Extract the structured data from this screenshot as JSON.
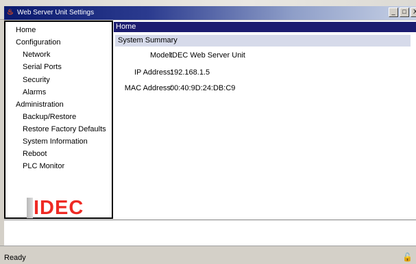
{
  "window": {
    "title": "Web Server Unit Settings",
    "icon": "java-cup-icon",
    "buttons": [
      "_",
      "□",
      "X"
    ]
  },
  "sidebar": {
    "items": [
      {
        "label": "Home",
        "level": 0
      },
      {
        "label": "Configuration",
        "level": 0
      },
      {
        "label": "Network",
        "level": 1
      },
      {
        "label": "Serial Ports",
        "level": 1
      },
      {
        "label": "Security",
        "level": 1
      },
      {
        "label": "Alarms",
        "level": 1
      },
      {
        "label": "Administration",
        "level": 0
      },
      {
        "label": "Backup/Restore",
        "level": 1
      },
      {
        "label": "Restore Factory Defaults",
        "level": 1
      },
      {
        "label": "System Information",
        "level": 1
      },
      {
        "label": "Reboot",
        "level": 1
      },
      {
        "label": "PLC Monitor",
        "level": 1
      }
    ],
    "logo_text": "IDEC"
  },
  "main": {
    "header": "Home",
    "section_title": "System Summary",
    "rows": [
      {
        "label": "Model:",
        "value": "IDEC Web Server Unit"
      },
      {
        "label": "IP Address:",
        "value": "192.168.1.5"
      },
      {
        "label": "MAC Address:",
        "value": "00:40:9D:24:DB:C9"
      }
    ]
  },
  "status": {
    "text": "Ready",
    "icon": "lock-icon"
  },
  "colors": {
    "header_bg": "#1c1c70",
    "section_bg": "#d6daea",
    "logo_red": "#ee2a24"
  }
}
